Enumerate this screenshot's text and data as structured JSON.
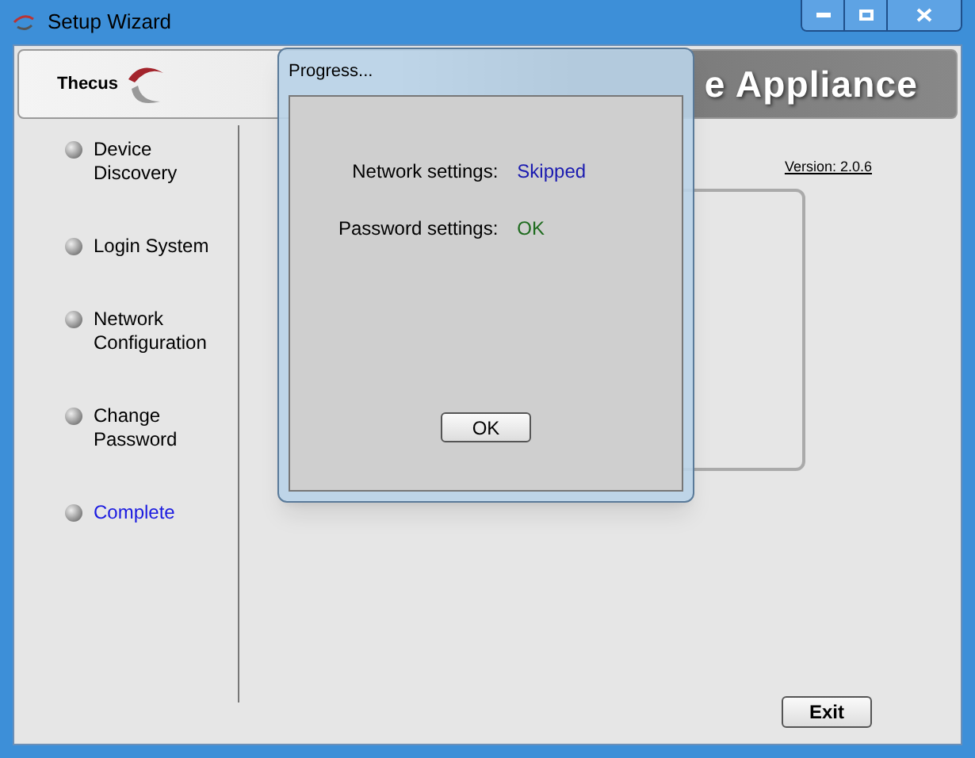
{
  "window": {
    "title": "Setup Wizard"
  },
  "banner": {
    "logo": "Thecus",
    "tagline": "e Appliance"
  },
  "steps": [
    {
      "label": "Device Discovery",
      "selected": false
    },
    {
      "label": "Login System",
      "selected": false
    },
    {
      "label": "Network Configuration",
      "selected": false
    },
    {
      "label": "Change Password",
      "selected": false
    },
    {
      "label": "Complete",
      "selected": true
    }
  ],
  "version_link": "Version: 2.0.6",
  "exit_button": "Exit",
  "dialog": {
    "title": "Progress...",
    "results": [
      {
        "label": "Network settings:",
        "value": "Skipped",
        "color": "#1a1ab0"
      },
      {
        "label": "Password settings:",
        "value": "OK",
        "color": "#1e6b1e"
      }
    ],
    "button": "OK"
  }
}
